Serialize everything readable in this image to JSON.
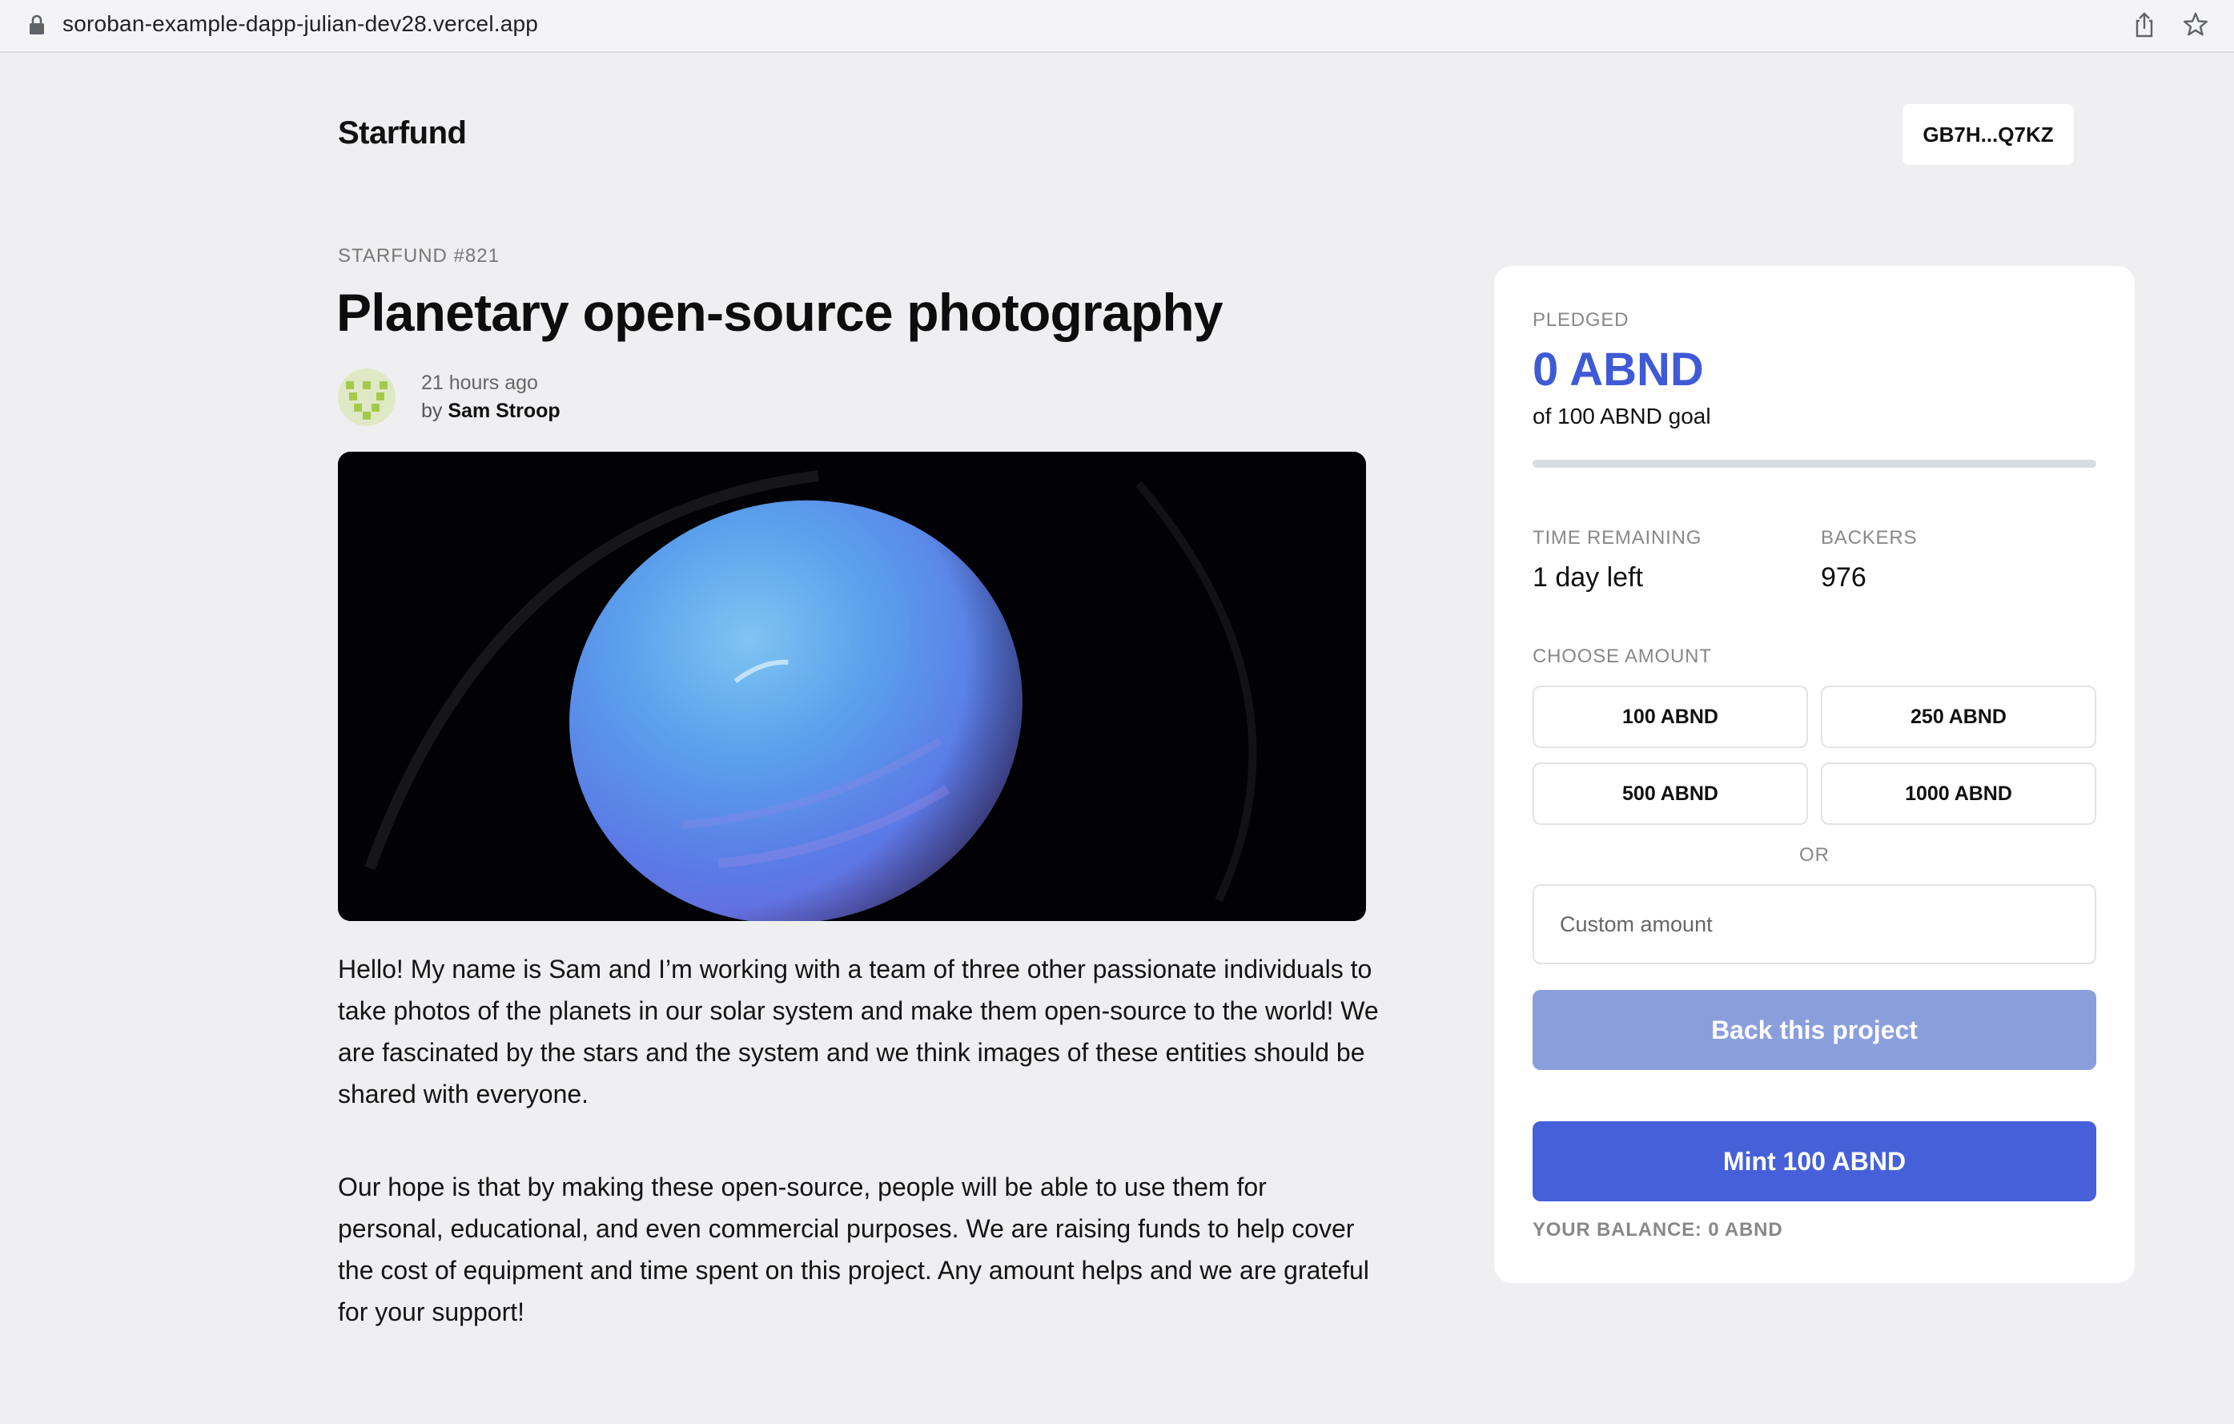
{
  "browser": {
    "url": "soroban-example-dapp-julian-dev28.vercel.app",
    "icons": [
      "lock-icon",
      "share-icon",
      "star-icon"
    ]
  },
  "header": {
    "logo": "Starfund",
    "wallet_address": "GB7H...Q7KZ"
  },
  "project": {
    "kicker": "STARFUND #821",
    "title": "Planetary open-source photography",
    "posted": "21 hours ago",
    "by_prefix": "by",
    "author": "Sam Stroop",
    "paragraphs": [
      "Hello! My name is Sam and I’m working with a team of three other passionate individuals to take photos of the planets in our solar system and make them open-source to the world! We are fascinated by the stars and the system and we think images of these entities should be shared with everyone.",
      "Our hope is that by making these open-source, people will be able to use them for personal, educational, and even commercial purposes. We are raising funds to help cover the cost of equipment and time spent on this project. Any amount helps and we are grateful for your support!"
    ]
  },
  "card": {
    "pledged_label": "PLEDGED",
    "pledged_value": "0 ABND",
    "goal_text": "of 100 ABND goal",
    "progress_fraction": 0,
    "time_label": "TIME REMAINING",
    "time_value": "1 day left",
    "backers_label": "BACKERS",
    "backers_value": "976",
    "choose_label": "CHOOSE AMOUNT",
    "amounts": [
      "100 ABND",
      "250 ABND",
      "500 ABND",
      "1000 ABND"
    ],
    "or_label": "OR",
    "custom_placeholder": "Custom amount",
    "back_button": "Back this project",
    "mint_button": "Mint 100 ABND",
    "balance": "YOUR BALANCE: 0 ABND"
  },
  "colors": {
    "accent": "#4660d9",
    "accent_disabled": "#8b9edc",
    "page_bg": "#efeff1"
  }
}
